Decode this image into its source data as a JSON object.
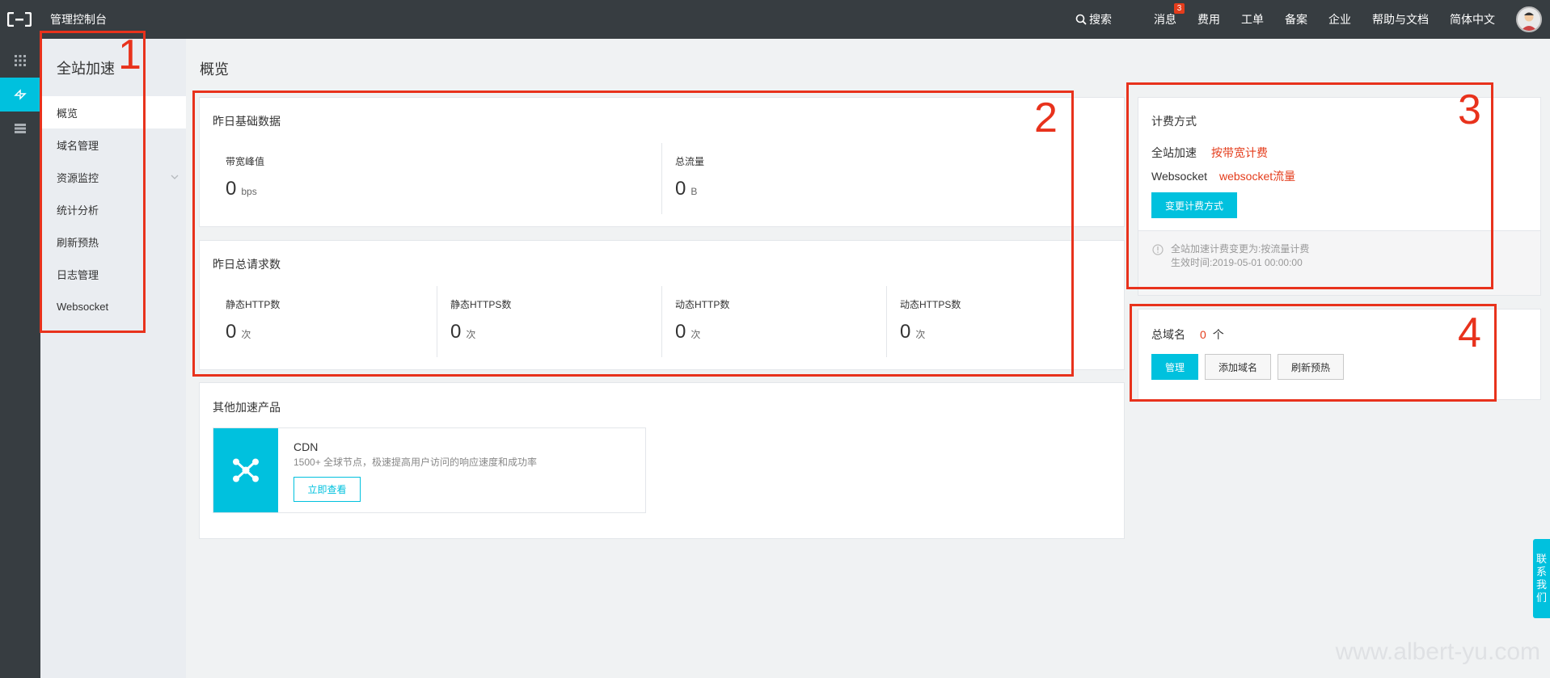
{
  "topbar": {
    "console_title": "管理控制台",
    "search": "搜索",
    "messages": "消息",
    "messages_badge": "3",
    "fees": "费用",
    "tickets": "工单",
    "icp": "备案",
    "enterprise": "企业",
    "help": "帮助与文档",
    "language": "简体中文"
  },
  "rail": {
    "items": [
      {
        "icon": "grid-icon"
      },
      {
        "icon": "dcdn-icon",
        "active": true
      },
      {
        "icon": "list-icon"
      }
    ]
  },
  "sidebar": {
    "title": "全站加速",
    "items": [
      {
        "label": "概览",
        "active": true
      },
      {
        "label": "域名管理"
      },
      {
        "label": "资源监控",
        "expandable": true
      },
      {
        "label": "统计分析"
      },
      {
        "label": "刷新预热"
      },
      {
        "label": "日志管理"
      },
      {
        "label": "Websocket"
      }
    ]
  },
  "main": {
    "page_title": "概览",
    "yesterday_basic": {
      "title": "昨日基础数据",
      "bandwidth_label": "带宽峰值",
      "bandwidth_value": "0",
      "bandwidth_unit": "bps",
      "traffic_label": "总流量",
      "traffic_value": "0",
      "traffic_unit": "B"
    },
    "yesterday_requests": {
      "title": "昨日总请求数",
      "stats": [
        {
          "label": "静态HTTP数",
          "value": "0",
          "unit": "次"
        },
        {
          "label": "静态HTTPS数",
          "value": "0",
          "unit": "次"
        },
        {
          "label": "动态HTTP数",
          "value": "0",
          "unit": "次"
        },
        {
          "label": "动态HTTPS数",
          "value": "0",
          "unit": "次"
        }
      ]
    },
    "other_products": {
      "title": "其他加速产品",
      "cdn_name": "CDN",
      "cdn_desc": "1500+ 全球节点，极速提高用户访问的响应速度和成功率",
      "cdn_button": "立即查看"
    }
  },
  "billing": {
    "title": "计费方式",
    "row1_label": "全站加速",
    "row1_value": "按带宽计费",
    "row2_label": "Websocket",
    "row2_value": "websocket流量",
    "change_button": "变更计费方式",
    "notice_line1": "全站加速计费变更为:按流量计费",
    "notice_line2": "生效时间:2019-05-01 00:00:00"
  },
  "domains": {
    "label": "总域名",
    "count": "0",
    "unit": "个",
    "manage_button": "管理",
    "add_button": "添加域名",
    "refresh_button": "刷新预热"
  },
  "annotations": [
    "1",
    "2",
    "3",
    "4"
  ],
  "contact_tab": [
    "联",
    "系",
    "我",
    "们"
  ],
  "watermark": "www.albert-yu.com",
  "colors": {
    "topbar": "#373d41",
    "accent": "#00c1de",
    "red": "#e43c1b",
    "annotation": "#e8321c"
  }
}
